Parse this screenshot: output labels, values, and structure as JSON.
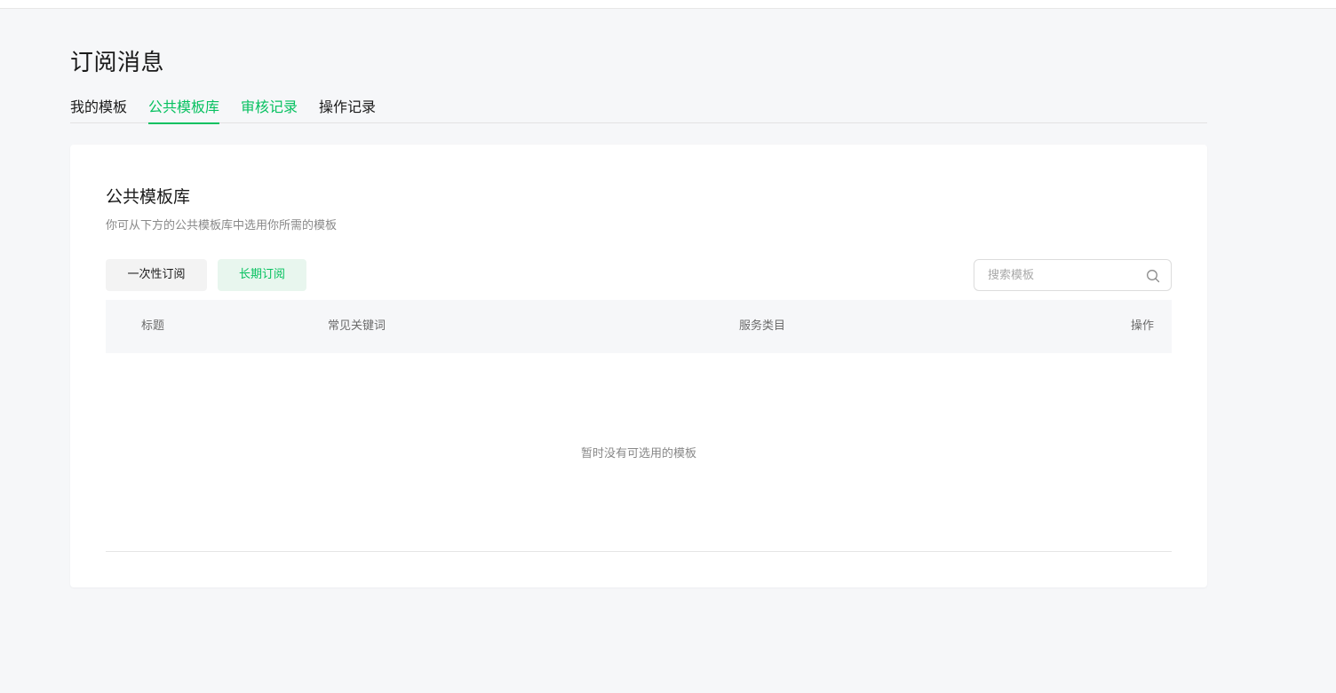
{
  "page": {
    "title": "订阅消息"
  },
  "tabs": [
    {
      "label": "我的模板",
      "state": "normal"
    },
    {
      "label": "公共模板库",
      "state": "active"
    },
    {
      "label": "审核记录",
      "state": "hover"
    },
    {
      "label": "操作记录",
      "state": "normal"
    }
  ],
  "card": {
    "title": "公共模板库",
    "description": "你可从下方的公共模板库中选用你所需的模板",
    "type_buttons": {
      "once": "一次性订阅",
      "long_term": "长期订阅",
      "selected": "long_term"
    },
    "search": {
      "placeholder": "搜索模板",
      "value": "",
      "icon": "search-icon"
    },
    "table": {
      "columns": [
        "标题",
        "常见关键词",
        "服务类目",
        "操作"
      ],
      "rows": [],
      "empty_text": "暂时没有可选用的模板"
    }
  },
  "colors": {
    "accent": "#07c160",
    "accent_light_bg": "#e8f6ee",
    "page_bg": "#f6f7f9",
    "card_bg": "#ffffff",
    "muted_text": "#888888"
  }
}
